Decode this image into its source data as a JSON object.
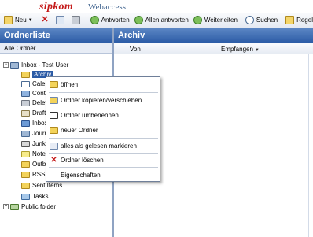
{
  "brand": {
    "logo": "sipkom",
    "product": "Webaccess"
  },
  "toolbar": {
    "new_label": "Neu",
    "reply_label": "Antworten",
    "reply_all_label": "Allen antworten",
    "forward_label": "Weiterleiten",
    "search_label": "Suchen",
    "rules_label": "Regeln"
  },
  "left_panel": {
    "title": "Ordnerliste",
    "subheader": "Alle Ordner",
    "root_label": "Inbox - Test User",
    "selected_label": "Archiv",
    "folders": [
      "Calendar",
      "Contacts",
      "Deleted Items",
      "Drafts",
      "Inbox",
      "Journal",
      "Junk E-mail",
      "Notes",
      "Outbox",
      "RSS Feeds",
      "Sent Items",
      "Tasks"
    ],
    "public_folder": "Public folder"
  },
  "right_panel": {
    "title": "Archiv",
    "columns": {
      "from": "Von",
      "received": "Empfangen"
    }
  },
  "context_menu": {
    "items": [
      "öffnen",
      "Ordner kopieren/verschieben",
      "Ordner umbenennen",
      "neuer Ordner",
      "alles als gelesen markieren",
      "Ordner löschen",
      "Eigenschaften"
    ]
  }
}
